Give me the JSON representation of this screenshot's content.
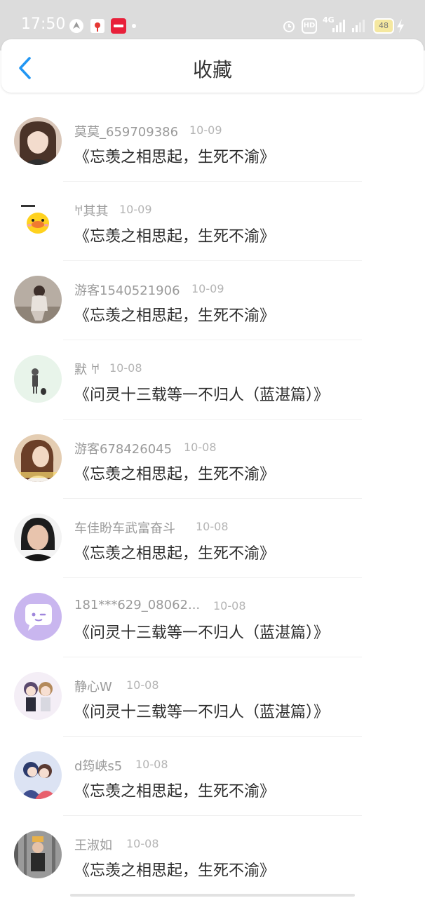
{
  "status_bar": {
    "time": "17:50",
    "left_icons": [
      "navigation-icon",
      "app-notification-icon",
      "shopping-app-icon",
      "dot-icon"
    ],
    "right_icons": [
      "alarm-icon",
      "hd-icon",
      "4g-signal-icon",
      "signal-icon",
      "battery-icon",
      "charging-icon"
    ],
    "hd_label": "HD",
    "network_label": "4G",
    "battery_level": "48"
  },
  "header": {
    "title": "收藏",
    "back_icon": "chevron-left-icon",
    "accent_color": "#2196f3"
  },
  "favorites": [
    {
      "username": "莫莫_659709386",
      "date": "10-09",
      "title": "《忘羡之相思起，生死不渝》",
      "avatar": "photo-girl"
    },
    {
      "username": "𐀀其其",
      "date": "10-09",
      "title": "《忘羡之相思起，生死不渝》",
      "avatar": "yellow-duck"
    },
    {
      "username": "游客1540521906",
      "date": "10-09",
      "title": "《忘羡之相思起，生死不渝》",
      "avatar": "photo-girl-sitting"
    },
    {
      "username": "默 𐀀",
      "date": "10-08",
      "title": "《问灵十三载等一不归人（蓝湛篇）》",
      "avatar": "sketch-figure"
    },
    {
      "username": "游客678426045",
      "date": "10-08",
      "title": "《忘羡之相思起，生死不渝》",
      "avatar": "photo-girl-brown"
    },
    {
      "username": "车佳盼车武富奋斗",
      "date": "10-08",
      "title": "《忘羡之相思起，生死不渝》",
      "avatar": "photo-woman"
    },
    {
      "username": "181***629_08062...",
      "date": "10-08",
      "title": "《问灵十三载等一不归人（蓝湛篇）》",
      "avatar": "purple-chat-bubble"
    },
    {
      "username": "静心W",
      "date": "10-08",
      "title": "《问灵十三载等一不归人（蓝湛篇）》",
      "avatar": "cartoon-couple"
    },
    {
      "username": "d筠峡s5",
      "date": "10-08",
      "title": "《忘羡之相思起，生死不渝》",
      "avatar": "anime-couple"
    },
    {
      "username": "王淑如",
      "date": "10-08",
      "title": "《忘羡之相思起，生死不渝》",
      "avatar": "photo-child"
    }
  ]
}
